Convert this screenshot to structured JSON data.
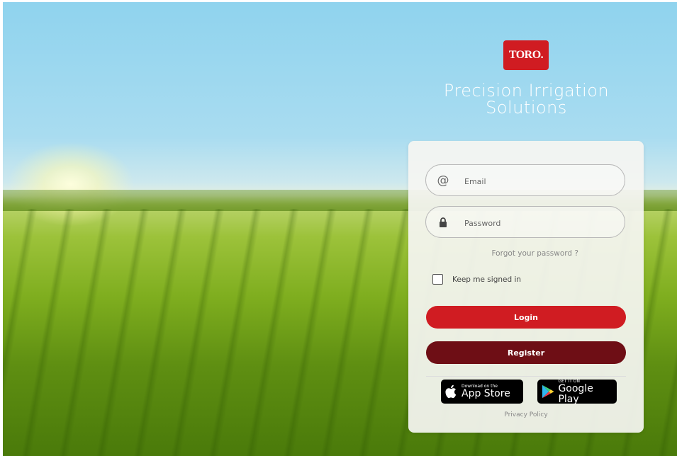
{
  "brand": {
    "logo_text": "TORO.",
    "title_line1": "Precision Irrigation",
    "title_line2": "Solutions"
  },
  "form": {
    "email_placeholder": "Email",
    "password_placeholder": "Password",
    "forgot_label": "Forgot your password ?",
    "remember_label": "Keep me signed in",
    "remember_checked": false,
    "login_label": "Login",
    "register_label": "Register"
  },
  "stores": {
    "appstore_small": "Download on the",
    "appstore_big": "App Store",
    "gplay_small": "GET IT ON",
    "gplay_big": "Google Play"
  },
  "footer": {
    "privacy_label": "Privacy Policy"
  },
  "colors": {
    "primary": "#d01c22",
    "secondary": "#6e0e15"
  }
}
